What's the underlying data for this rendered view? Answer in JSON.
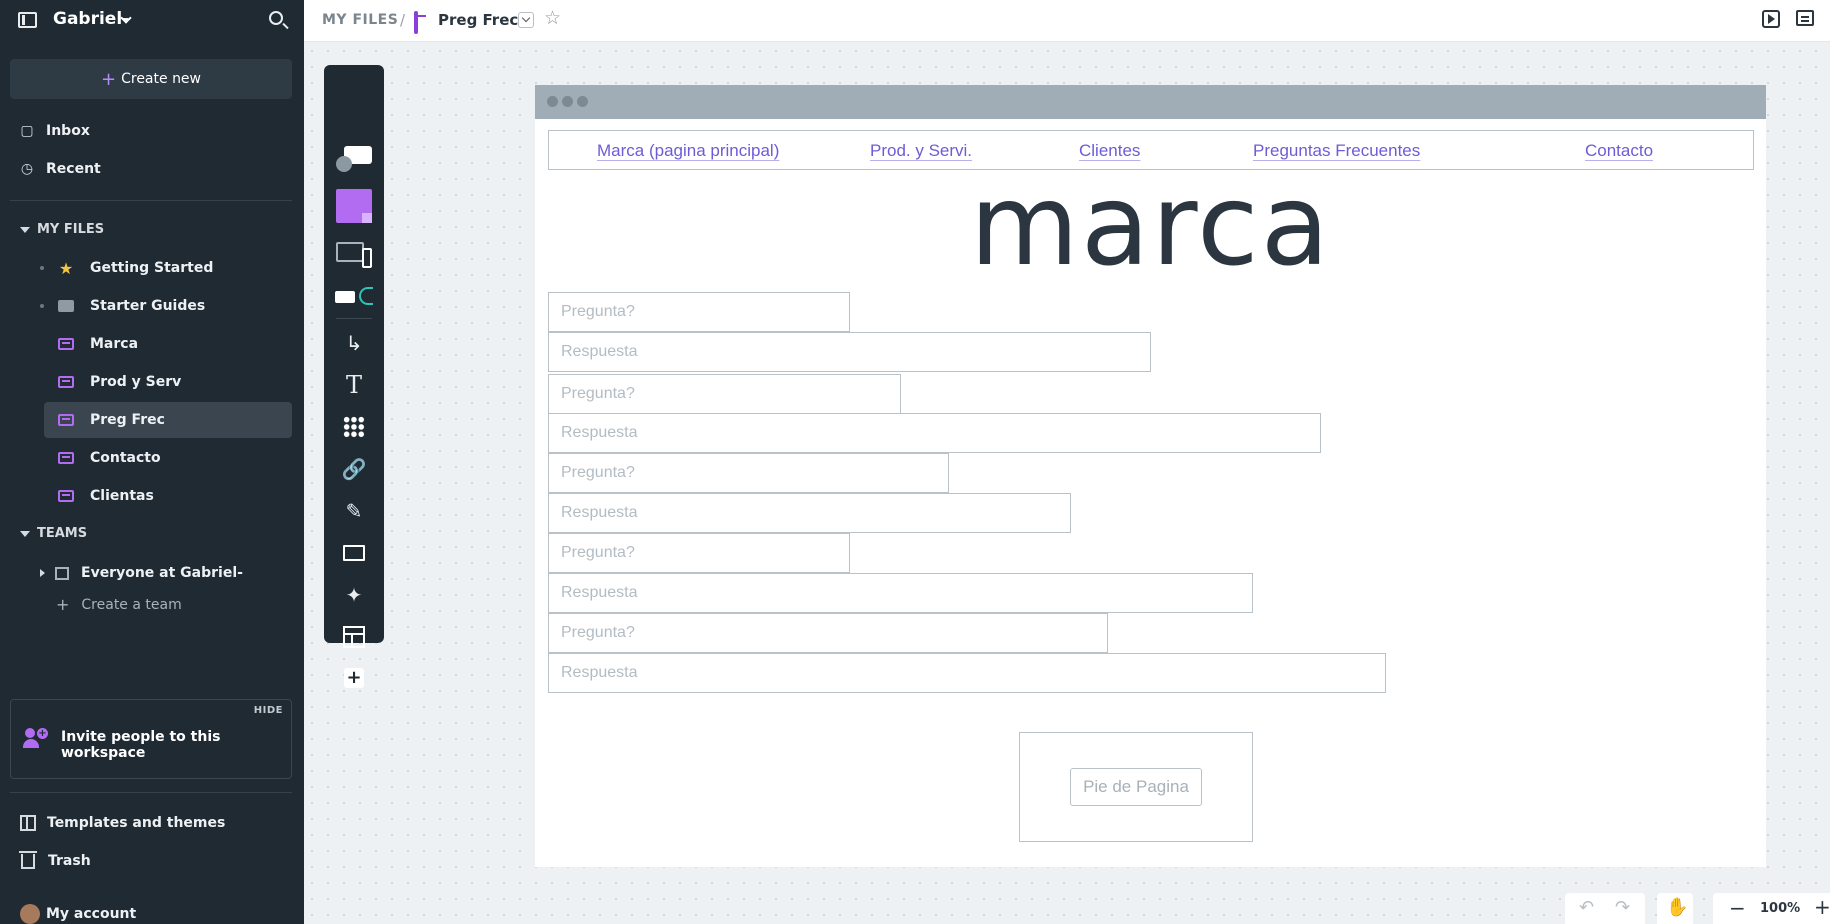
{
  "sidebar": {
    "workspace": "Gabriel-",
    "create_new": "Create new",
    "nav": [
      {
        "label": "Inbox",
        "icon": "inbox-icon"
      },
      {
        "label": "Recent",
        "icon": "clock-icon"
      }
    ],
    "my_files_label": "MY FILES",
    "files": [
      {
        "label": "Getting Started",
        "icon": "star-icon"
      },
      {
        "label": "Starter Guides",
        "icon": "folder-icon"
      },
      {
        "label": "Marca",
        "icon": "board-icon"
      },
      {
        "label": "Prod y Serv",
        "icon": "board-icon"
      },
      {
        "label": "Preg Frec",
        "icon": "board-icon",
        "active": true
      },
      {
        "label": "Contacto",
        "icon": "board-icon"
      },
      {
        "label": "Clientas",
        "icon": "board-icon"
      }
    ],
    "teams_label": "TEAMS",
    "team": "Everyone at Gabriel-",
    "create_team": "Create a team",
    "invite": {
      "hide": "HIDE",
      "text": "Invite people to this workspace"
    },
    "templates": "Templates and themes",
    "trash": "Trash",
    "account": "My account"
  },
  "topbar": {
    "root": "MY FILES",
    "separator": "/",
    "title": "Preg Frec"
  },
  "wireframe": {
    "nav_links": [
      "Marca (pagina principal)",
      "Prod. y Servi.",
      "Clientes",
      "Preguntas Frecuentes",
      "Contacto"
    ],
    "brand": "marca",
    "question_placeholder": "Pregunta?",
    "answer_placeholder": "Respuesta",
    "footer": "Pie de Pagina"
  },
  "zoom": {
    "level": "100%"
  },
  "colors": {
    "accent": "#b26cf2",
    "sidebar_bg": "#1f2a33",
    "link": "#6d5cd6"
  }
}
